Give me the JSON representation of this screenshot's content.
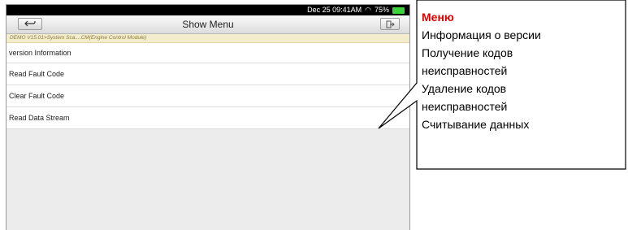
{
  "device": {
    "status_bar": {
      "datetime": "Dec 25 09:41AM",
      "battery": "75%"
    },
    "title": "Show Menu",
    "breadcrumb": "DEMO V15.01>System Sca....CM(Engine Control Module)",
    "menu_items": [
      {
        "label": "version Information"
      },
      {
        "label": "Read Fault Code"
      },
      {
        "label": "Clear Fault Code"
      },
      {
        "label": "Read Data Stream"
      }
    ],
    "icons": {
      "back": "back-arrow-icon",
      "exit": "exit-icon",
      "wifi": "wifi-icon",
      "battery": "battery-icon"
    }
  },
  "callout": {
    "title": "Меню",
    "lines": [
      "Информация о версии",
      "Получение кодов",
      "неисправностей",
      "Удаление кодов",
      "неисправностей",
      "Считывание данных"
    ],
    "title_color": "#e00000"
  }
}
